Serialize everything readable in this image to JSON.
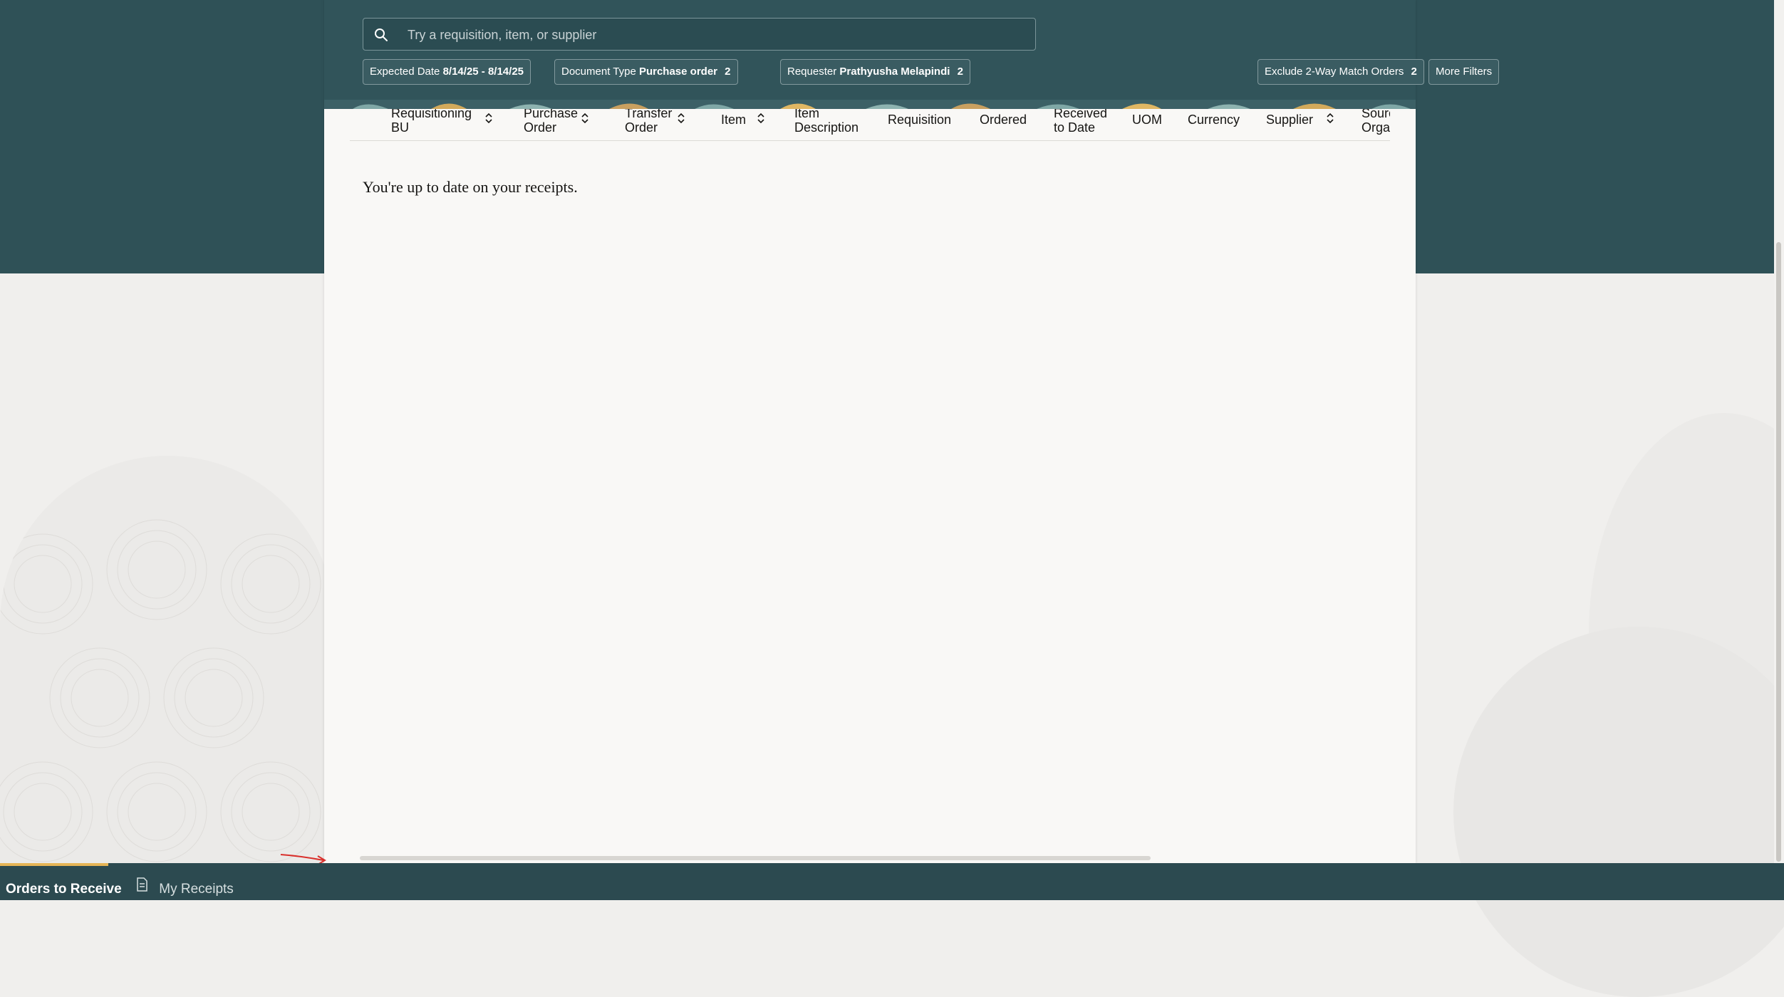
{
  "search": {
    "placeholder": "Try a requisition, item, or supplier",
    "value": ""
  },
  "filters": [
    {
      "label": "Expected Date",
      "value": "8/14/25 - 8/14/25",
      "count": ""
    },
    {
      "label": "Document Type",
      "value": "Purchase order",
      "count": "2"
    },
    {
      "label": "Requester",
      "value": "Prathyusha Melapindi",
      "count": "2"
    },
    {
      "label": "Exclude 2-Way Match Orders",
      "value": "",
      "count": "2"
    },
    {
      "label": "More Filters",
      "value": "",
      "count": ""
    }
  ],
  "table": {
    "columns": [
      {
        "line1": "Requisitioning",
        "line2": "BU",
        "sortable": true
      },
      {
        "line1": "Purchase",
        "line2": "Order",
        "sortable": true
      },
      {
        "line1": "Transfer",
        "line2": "Order",
        "sortable": true
      },
      {
        "line1": "Item",
        "line2": "",
        "sortable": true
      },
      {
        "line1": "Item",
        "line2": "Description",
        "sortable": false
      },
      {
        "line1": "Requisition",
        "line2": "",
        "sortable": false
      },
      {
        "line1": "Ordered",
        "line2": "",
        "sortable": false
      },
      {
        "line1": "Received",
        "line2": "to Date",
        "sortable": false
      },
      {
        "line1": "UOM",
        "line2": "",
        "sortable": false
      },
      {
        "line1": "Currency",
        "line2": "",
        "sortable": false
      },
      {
        "line1": "Supplier",
        "line2": "",
        "sortable": true
      },
      {
        "line1": "Source",
        "line2": "Organization",
        "sortable": false
      }
    ],
    "empty_message": "You're up to date on your receipts."
  },
  "bottom_tabs": [
    {
      "label": "Orders to Receive",
      "active": true
    },
    {
      "label": "My Receipts",
      "active": false
    }
  ],
  "colors": {
    "header_teal": "#2f5157",
    "bottom_bar": "#2c4a50",
    "accent_gold": "#e5b556",
    "annotation_red": "#d9302c"
  },
  "icons": {
    "search": "search-icon",
    "sort": "sort-icon",
    "receipts": "document-icon"
  }
}
